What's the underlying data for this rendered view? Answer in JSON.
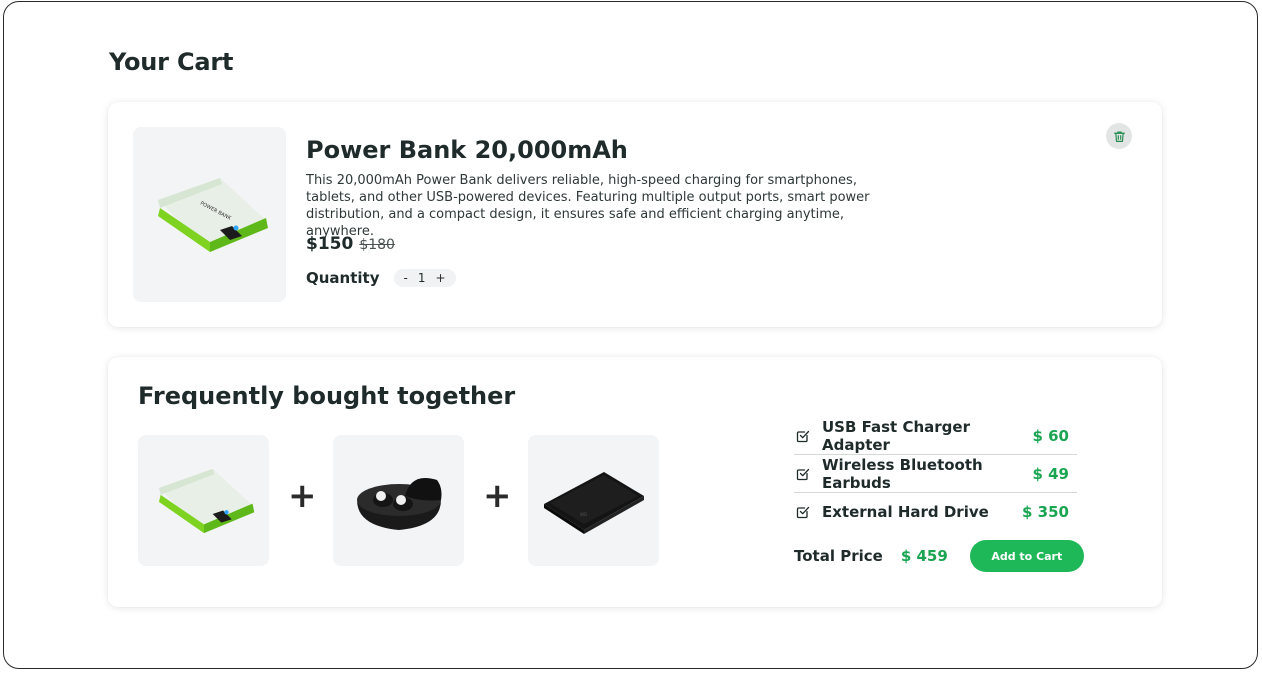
{
  "page": {
    "title": "Your Cart"
  },
  "cart_item": {
    "name": "Power Bank 20,000mAh",
    "description": "This 20,000mAh Power Bank delivers reliable, high-speed charging for smartphones, tablets, and other USB-powered devices. Featuring multiple output ports, smart power distribution, and a compact design, it ensures safe and efficient charging anytime, anywhere.",
    "price": "$150",
    "old_price": "$180",
    "quantity_label": "Quantity",
    "quantity_minus": "-",
    "quantity_value": "1",
    "quantity_plus": "+",
    "image_icon": "power-bank-image",
    "remove_icon": "trash-icon"
  },
  "bundle": {
    "title": "Frequently bought together",
    "plus_sign": "+",
    "images": [
      "power-bank-image",
      "earbuds-image",
      "hard-drive-image"
    ],
    "items": [
      {
        "name": "USB Fast Charger Adapter",
        "price": "$ 60",
        "checked": true
      },
      {
        "name": "Wireless Bluetooth Earbuds",
        "price": "$ 49",
        "checked": true
      },
      {
        "name": "External Hard Drive",
        "price": "$ 350",
        "checked": true
      }
    ],
    "total_label": "Total Price",
    "total_price": "$ 459",
    "add_button": "Add to Cart"
  },
  "colors": {
    "accent": "#1fb859",
    "price_green": "#1ba552",
    "text": "#1f2a2a",
    "thumb_bg": "#f3f4f6"
  }
}
